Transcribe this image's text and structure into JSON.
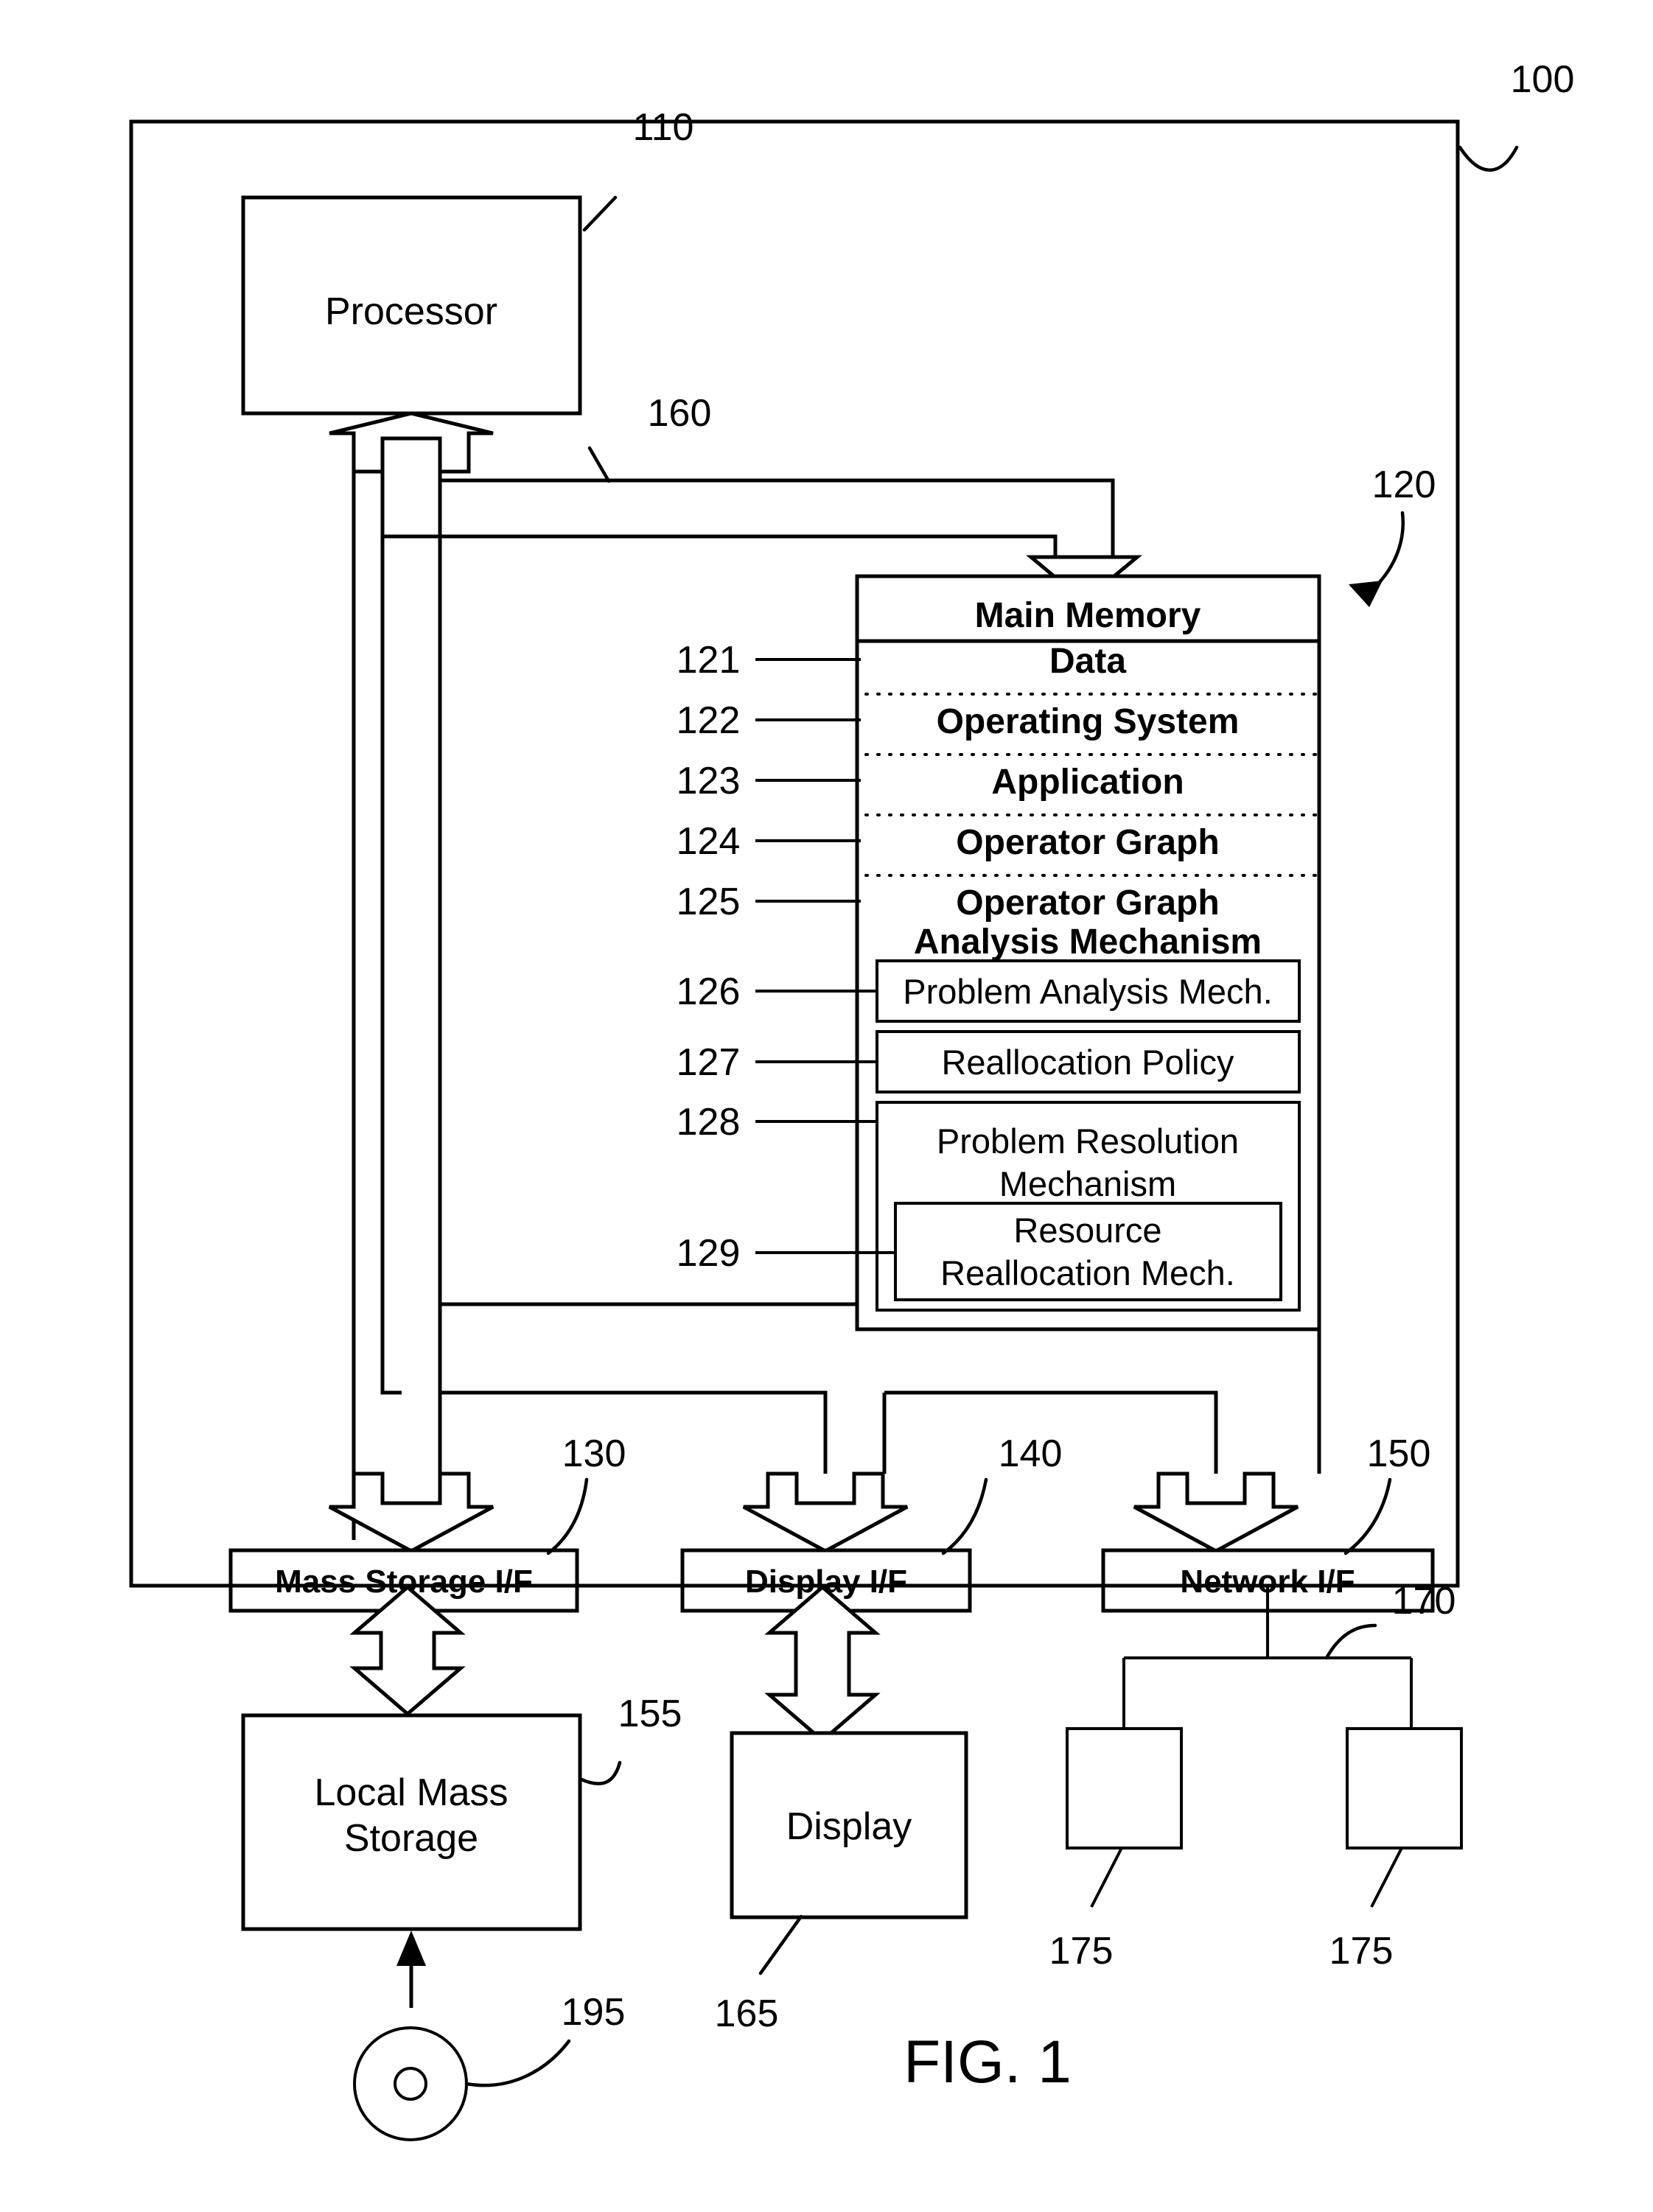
{
  "figure": {
    "caption": "FIG. 1",
    "system_ref": "100",
    "processor": {
      "label": "Processor",
      "ref": "110"
    },
    "bus": {
      "ref": "160"
    },
    "memory": {
      "ref": "120",
      "title": "Main Memory",
      "segments": [
        {
          "ref": "121",
          "label": "Data"
        },
        {
          "ref": "122",
          "label": "Operating System"
        },
        {
          "ref": "123",
          "label": "Application"
        },
        {
          "ref": "124",
          "label": "Operator Graph"
        },
        {
          "ref": "125",
          "label_line1": "Operator Graph",
          "label_line2": "Analysis Mechanism"
        }
      ],
      "modules": [
        {
          "ref": "126",
          "label": "Problem Analysis Mech."
        },
        {
          "ref": "127",
          "label": "Reallocation Policy"
        },
        {
          "ref": "128",
          "label_line1": "Problem Resolution",
          "label_line2": "Mechanism"
        },
        {
          "ref": "129",
          "label_line1": "Resource",
          "label_line2": "Reallocation Mech."
        }
      ]
    },
    "interfaces": [
      {
        "ref": "130",
        "label": "Mass Storage I/F"
      },
      {
        "ref": "140",
        "label": "Display I/F"
      },
      {
        "ref": "150",
        "label": "Network I/F"
      }
    ],
    "devices": [
      {
        "ref": "155",
        "label_line1": "Local Mass",
        "label_line2": "Storage"
      },
      {
        "ref": "165",
        "label": "Display"
      }
    ],
    "network": {
      "ref": "170",
      "nodes": [
        {
          "ref": "175"
        },
        {
          "ref": "175"
        }
      ]
    },
    "media": {
      "ref": "195",
      "name": "optical-disc"
    }
  }
}
